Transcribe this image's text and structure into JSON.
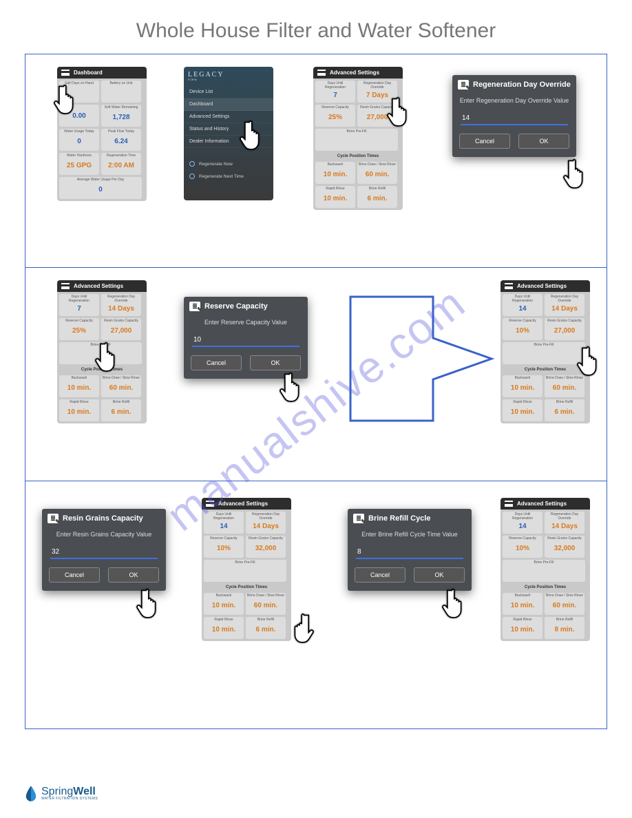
{
  "watermark": "manualshive.com",
  "page_title": "Whole House Filter and Water Softener",
  "footer": {
    "brand1": "Spring",
    "brand2": "Well",
    "tagline": "WATER FILTRATION SYSTEMS"
  },
  "screens": {
    "dashboard": {
      "title": "Dashboard",
      "tiles": [
        {
          "lbl": "Salt Days on Hand",
          "val": "",
          "cls": "orange"
        },
        {
          "lbl": "Battery on Unit",
          "val": "",
          "cls": ""
        },
        {
          "lbl": "",
          "val": "0.00",
          "cls": "blue"
        },
        {
          "lbl": "Soft Water Remaining",
          "val": "1,728",
          "cls": "blue"
        },
        {
          "lbl": "Water Usage Today",
          "val": "0",
          "cls": "blue"
        },
        {
          "lbl": "Peak Flow Today",
          "val": "6.24",
          "cls": "blue"
        },
        {
          "lbl": "Water Hardness",
          "val": "25 GPG",
          "cls": "orange"
        },
        {
          "lbl": "Regeneration Time",
          "val": "2:00 AM",
          "cls": "orange"
        },
        {
          "lbl": "Average Water Usage Per Day",
          "val": "0",
          "cls": "blue",
          "full": true
        }
      ]
    },
    "legacy_menu": {
      "logo": "LEGACY",
      "items": [
        "Device List",
        "Dashboard",
        "Advanced Settings",
        "Status and History",
        "Dealer Information"
      ],
      "selected": 1,
      "radios": [
        "Regenerate Now",
        "Regenerate Next Time"
      ]
    },
    "adv1": {
      "title": "Advanced Settings",
      "tiles_top": [
        {
          "lbl": "Days Until Regeneration",
          "val": "7",
          "cls": "blue"
        },
        {
          "lbl": "Regeneration Day Override",
          "val": "7 Days",
          "cls": "orange"
        },
        {
          "lbl": "Reserve Capacity",
          "val": "25%",
          "cls": "orange"
        },
        {
          "lbl": "Resin Grains Capacity",
          "val": "27,000",
          "cls": "orange"
        }
      ],
      "prefill": {
        "lbl": "Brine Pre-Fill",
        "val": ""
      },
      "section": "Cycle Position Times",
      "tiles_bot": [
        {
          "lbl": "Backwash",
          "val": "10 min.",
          "cls": "orange"
        },
        {
          "lbl": "Brine Draw / Slow Rinse",
          "val": "60 min.",
          "cls": "orange"
        },
        {
          "lbl": "Rapid Rinse",
          "val": "10 min.",
          "cls": "orange"
        },
        {
          "lbl": "Brine Refill",
          "val": "6 min.",
          "cls": "orange"
        }
      ]
    },
    "adv2": {
      "title": "Advanced Settings",
      "tiles_top": [
        {
          "lbl": "Days Until Regeneration",
          "val": "7",
          "cls": "blue"
        },
        {
          "lbl": "Regeneration Day Override",
          "val": "14 Days",
          "cls": "orange"
        },
        {
          "lbl": "Reserve Capacity",
          "val": "25%",
          "cls": "orange"
        },
        {
          "lbl": "Resin Grains Capacity",
          "val": "27,000",
          "cls": "orange"
        }
      ],
      "prefill": {
        "lbl": "Brine Pre-Fill",
        "val": ""
      },
      "section": "Cycle Position Times",
      "tiles_bot": [
        {
          "lbl": "Backwash",
          "val": "10 min.",
          "cls": "orange"
        },
        {
          "lbl": "Brine Draw / Slow Rinse",
          "val": "60 min.",
          "cls": "orange"
        },
        {
          "lbl": "Rapid Rinse",
          "val": "10 min.",
          "cls": "orange"
        },
        {
          "lbl": "Brine Refill",
          "val": "6 min.",
          "cls": "orange"
        }
      ]
    },
    "adv3": {
      "title": "Advanced Settings",
      "tiles_top": [
        {
          "lbl": "Days Until Regeneration",
          "val": "14",
          "cls": "blue"
        },
        {
          "lbl": "Regeneration Day Override",
          "val": "14 Days",
          "cls": "orange"
        },
        {
          "lbl": "Reserve Capacity",
          "val": "10%",
          "cls": "orange"
        },
        {
          "lbl": "Resin Grains Capacity",
          "val": "27,000",
          "cls": "orange"
        }
      ],
      "prefill": {
        "lbl": "Brine Pre-Fill",
        "val": ""
      },
      "section": "Cycle Position Times",
      "tiles_bot": [
        {
          "lbl": "Backwash",
          "val": "10 min.",
          "cls": "orange"
        },
        {
          "lbl": "Brine Draw / Slow Rinse",
          "val": "60 min.",
          "cls": "orange"
        },
        {
          "lbl": "Rapid Rinse",
          "val": "10 min.",
          "cls": "orange"
        },
        {
          "lbl": "Brine Refill",
          "val": "6 min.",
          "cls": "orange"
        }
      ]
    },
    "adv4": {
      "title": "Advanced Settings",
      "tiles_top": [
        {
          "lbl": "Days Until Regeneration",
          "val": "14",
          "cls": "blue"
        },
        {
          "lbl": "Regeneration Day Override",
          "val": "14 Days",
          "cls": "orange"
        },
        {
          "lbl": "Reserve Capacity",
          "val": "10%",
          "cls": "orange"
        },
        {
          "lbl": "Resin Grains Capacity",
          "val": "32,000",
          "cls": "orange"
        }
      ],
      "prefill": {
        "lbl": "Brine Pre-Fill",
        "val": ""
      },
      "section": "Cycle Position Times",
      "tiles_bot": [
        {
          "lbl": "Backwash",
          "val": "10 min.",
          "cls": "orange"
        },
        {
          "lbl": "Brine Draw / Slow Rinse",
          "val": "60 min.",
          "cls": "orange"
        },
        {
          "lbl": "Rapid Rinse",
          "val": "10 min.",
          "cls": "orange"
        },
        {
          "lbl": "Brine Refill",
          "val": "6 min.",
          "cls": "orange"
        }
      ]
    },
    "adv5": {
      "title": "Advanced Settings",
      "tiles_top": [
        {
          "lbl": "Days Until Regeneration",
          "val": "14",
          "cls": "blue"
        },
        {
          "lbl": "Regeneration Day Override",
          "val": "14 Days",
          "cls": "orange"
        },
        {
          "lbl": "Reserve Capacity",
          "val": "10%",
          "cls": "orange"
        },
        {
          "lbl": "Resin Grains Capacity",
          "val": "32,000",
          "cls": "orange"
        }
      ],
      "prefill": {
        "lbl": "Brine Pre-Fill",
        "val": ""
      },
      "section": "Cycle Position Times",
      "tiles_bot": [
        {
          "lbl": "Backwash",
          "val": "10 min.",
          "cls": "orange"
        },
        {
          "lbl": "Brine Draw / Slow Rinse",
          "val": "60 min.",
          "cls": "orange"
        },
        {
          "lbl": "Rapid Rinse",
          "val": "10 min.",
          "cls": "orange"
        },
        {
          "lbl": "Brine Refill",
          "val": "8 min.",
          "cls": "orange"
        }
      ]
    }
  },
  "modals": {
    "regen": {
      "title": "Regeneration Day Override",
      "sub": "Enter Regeneration Day Override Value",
      "value": "14",
      "cancel": "Cancel",
      "ok": "OK"
    },
    "reserve": {
      "title": "Reserve Capacity",
      "sub": "Enter Reserve Capacity Value",
      "value": "10",
      "cancel": "Cancel",
      "ok": "OK"
    },
    "resin": {
      "title": "Resin Grains Capacity",
      "sub": "Enter Resin Grains Capacity Value",
      "value": "32",
      "cancel": "Cancel",
      "ok": "OK"
    },
    "brine": {
      "title": "Brine Refill Cycle",
      "sub": "Enter Brine Refill Cycle Time Value",
      "value": "8",
      "cancel": "Cancel",
      "ok": "OK"
    }
  }
}
